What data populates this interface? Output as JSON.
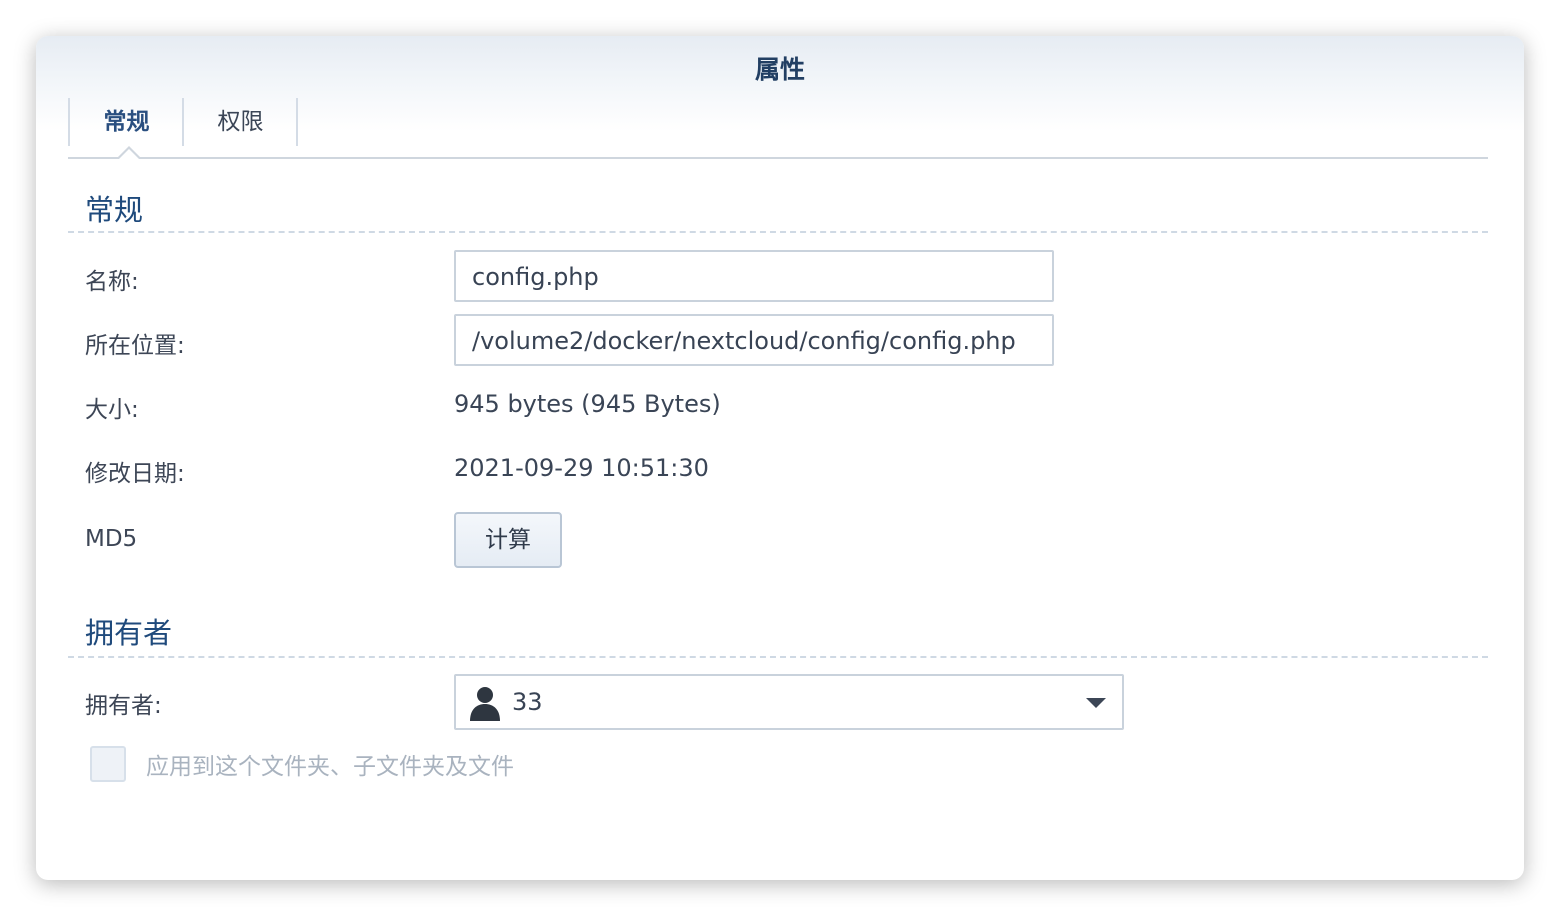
{
  "window": {
    "title": "属性"
  },
  "tabs": [
    {
      "label": "常规",
      "active": true
    },
    {
      "label": "权限",
      "active": false
    }
  ],
  "general": {
    "section_title": "常规",
    "name_label": "名称:",
    "name_value": "config.php",
    "location_label": "所在位置:",
    "location_value": "/volume2/docker/nextcloud/config/config.php",
    "size_label": "大小:",
    "size_value": "945 bytes (945 Bytes)",
    "modified_label": "修改日期:",
    "modified_value": "2021-09-29 10:51:30",
    "md5_label": "MD5",
    "md5_button": "计算"
  },
  "owner": {
    "section_title": "拥有者",
    "owner_label": "拥有者:",
    "owner_value": "33",
    "owner_icon": "user-icon",
    "apply_checkbox_label": "应用到这个文件夹、子文件夹及文件",
    "apply_checked": false
  },
  "colors": {
    "accent": "#1f4a7c",
    "title": "#223f63",
    "border": "#c9d2dc",
    "disabled_text": "#a9b3bf"
  }
}
